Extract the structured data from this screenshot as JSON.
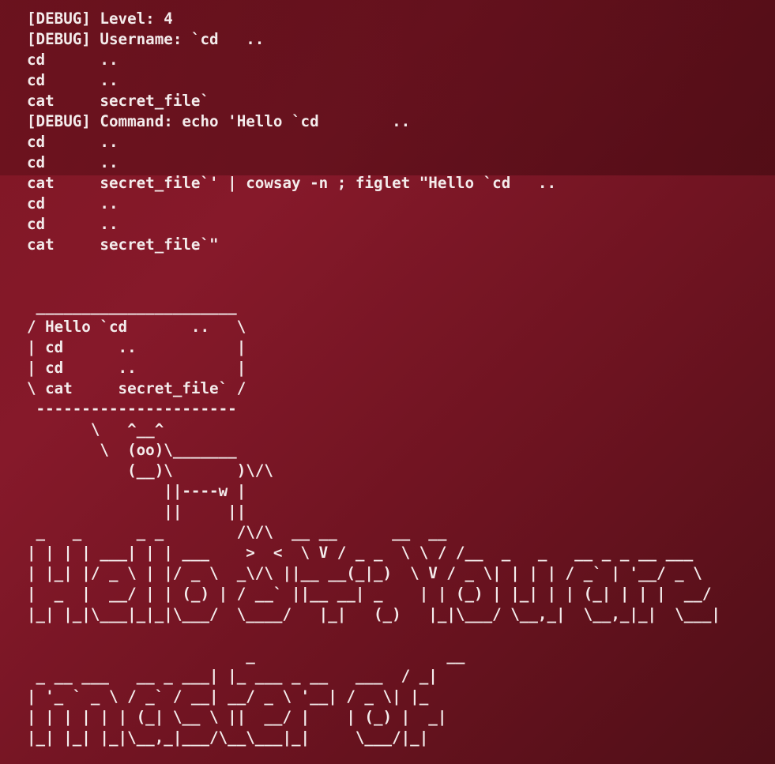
{
  "terminal": {
    "output": "[DEBUG] Level: 4\n[DEBUG] Username: `cd   ..\ncd      ..\ncd      ..\ncat     secret_file`\n[DEBUG] Command: echo 'Hello `cd        ..\ncd      ..\ncd      ..\ncat     secret_file`' | cowsay -n ; figlet \"Hello `cd   ..\ncd      ..\ncd      ..\ncat     secret_file`\"\n\n\n ______________________\n/ Hello `cd       ..   \\\n| cd      ..           |\n| cd      ..           |\n\\ cat     secret_file` /\n ----------------------\n       \\   ^__^\n        \\  (oo)\\_______\n           (__)\\       )\\/\\\n               ||----w |\n               ||     ||\n _   _      _ _        /\\/\\  __ __      __  __\n| | | | ___| | | ___    >  <  \\ V / _ _  \\ \\ / /__  _   _   __ _ _ __ ___\n| |_| |/ _ \\ | |/ _ \\  _\\/\\ ||__ __(_|_)  \\ V / _ \\| | | | / _` | '__/ _ \\\n|  _  |  __/ | | (_) | / __` ||__ __| _    | | (_) | |_| | | (_| | | |  __/\n|_| |_|\\___|_|_|\\___/  \\____/   |_|   (_)   |_|\\___/ \\__,_|  \\__,_|_|  \\___|\n\n                        _                     __\n _ __ ___   __ _ ___| |_ ___ _ __   ___  / _|\n| '_ ` _ \\ / _` / __| __/ _ \\ '__| / _ \\| |_\n| | | | | | (_| \\__ \\ ||  __/ |    | (_) |  _|\n|_| |_| |_|\\__,_|___/\\__\\___|_|     \\___/|_|"
  }
}
